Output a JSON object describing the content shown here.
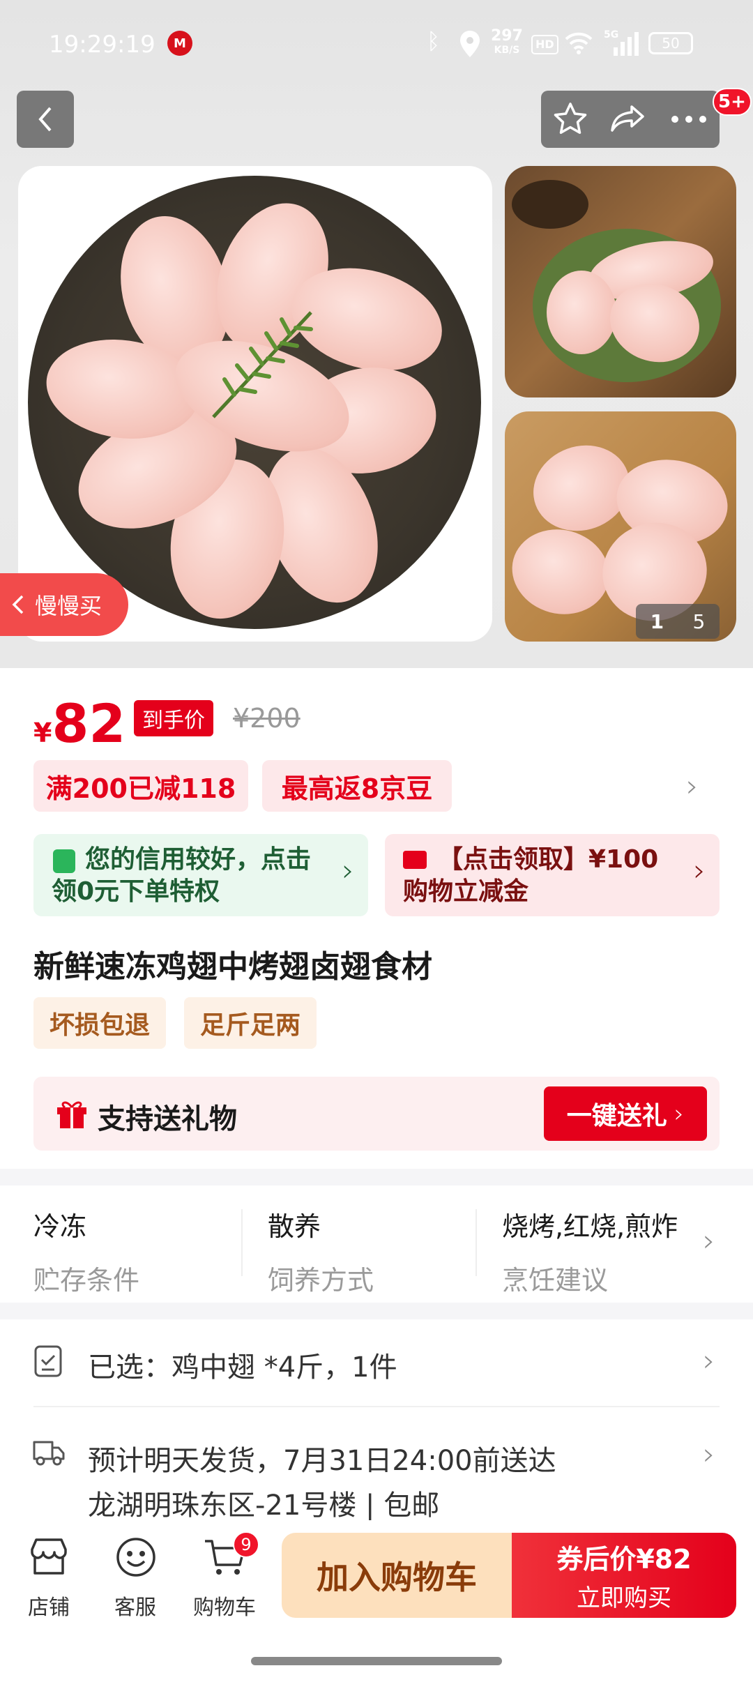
{
  "status_bar": {
    "time": "19:29:19",
    "net_speed_value": "297",
    "net_speed_unit": "KB/S",
    "hd": "HD",
    "network": "5G",
    "battery": "50"
  },
  "nav": {
    "cart_badge": "5+"
  },
  "gallery": {
    "slow_buy_label": "慢慢买",
    "page_current": "1",
    "page_total": "5"
  },
  "price": {
    "currency": "¥",
    "amount": "82",
    "final_price_label": "到手价",
    "original_price": "¥200"
  },
  "promos": {
    "discount": "满200已减118",
    "beans": "最高返8京豆"
  },
  "benefits": {
    "credit": "您的信用较好，点击领0元下单特权",
    "coupon": "【点击领取】¥100购物立减金"
  },
  "product": {
    "title": "新鲜速冻鸡翅中烤翅卤翅食材",
    "tags": [
      "坏损包退",
      "足斤足两"
    ]
  },
  "gift": {
    "label": "支持送礼物",
    "button": "一键送礼"
  },
  "specs": [
    {
      "value": "冷冻",
      "key": "贮存条件"
    },
    {
      "value": "散养",
      "key": "饲养方式"
    },
    {
      "value": "烧烤,红烧,煎炸",
      "key": "烹饪建议"
    }
  ],
  "selection": {
    "text": "已选：鸡中翅 *4斤，1件"
  },
  "delivery": {
    "line1": "预计明天发货，7月31日24:00前送达",
    "line2": "龙湖明珠东区-21号楼 | 包邮"
  },
  "bottom_bar": {
    "shop": "店铺",
    "service": "客服",
    "cart": "购物车",
    "cart_badge": "9",
    "add_to_cart": "加入购物车",
    "buy_price": "券后价¥82",
    "buy_now": "立即购买"
  },
  "colors": {
    "accent_red": "#e4001b",
    "promo_bg": "#fde8ea",
    "green_bg": "#eaf8ef",
    "cart_btn": "#fde0bd"
  }
}
